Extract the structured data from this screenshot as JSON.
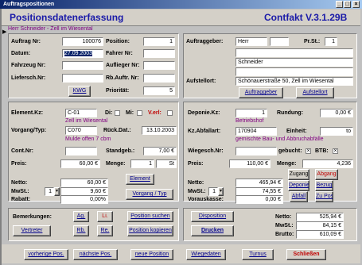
{
  "window": {
    "title": "Auftragspositionen",
    "minimize": "_",
    "maximize": "□",
    "close": "×"
  },
  "header": {
    "title": "Positionsdatenerfassung",
    "version": "Contfakt V.3.1.29B",
    "subtitle": "Herr Schneider - Zell im Wiesental"
  },
  "order": {
    "auftrag_nr_label": "Auftrag Nr:",
    "auftrag_nr": "100076",
    "position_label": "Position:",
    "position": "1",
    "datum_label": "Datum:",
    "datum": "27.09.2003",
    "fahrer_label": "Fahrer Nr:",
    "fahrer": "",
    "fahrzeug_label": "Fahrzeug Nr:",
    "fahrzeug": "",
    "auflieger_label": "Auflieger Nr:",
    "auflieger": "",
    "lieferschein_label": "Liefersch.Nr:",
    "lieferschein": "",
    "rb_label": "Rb.Auftr. Nr:",
    "rb": "",
    "prioritaet_label": "Priorität:",
    "prioritaet": "5",
    "kwg_button": "KWG"
  },
  "client": {
    "auftraggeber_label": "Auftraggeber:",
    "anrede": "Herr",
    "field2": "",
    "prst_label": "Pr.St.:",
    "prst": "1",
    "line1": "",
    "line2": "Schneider",
    "line3": "",
    "aufstellort_label": "Aufstellort:",
    "aufstellort": "Schönauerstraße 50, Zell im Wiesental",
    "auftraggeber_button": "Auftraggeber",
    "aufstellort_button": "Aufstellort"
  },
  "element": {
    "kz_label": "Element.Kz:",
    "kz": "C-01",
    "di_label": "Di:",
    "mi_label": "Mi:",
    "verl_label": "V.erl:",
    "location": "Zell im Wiesental",
    "vorgang_label": "Vorgang/Typ:",
    "vorgang": "C070",
    "rueck_label": "Rück.Dat.:",
    "rueck": "13.10.2003",
    "note": "Mulde offen 7 cbm",
    "cont_label": "Cont.Nr:",
    "cont": "",
    "standgeb_label": "Standgeb.:",
    "standgeb": "7,00 €",
    "preis_label": "Preis:",
    "preis": "60,00 €",
    "menge_label": "Menge:",
    "menge": "1",
    "einheit": "St",
    "element_button": "Element",
    "vorgang_button": "Vorgang / Typ",
    "netto_label": "Netto:",
    "netto": "60,00 €",
    "mwst_label": "MwSt.:",
    "mwst_code": "1",
    "mwst": "9,60 €",
    "rabatt_label": "Rabatt:",
    "rabatt": "0,00%"
  },
  "deponie": {
    "kz_label": "Deponie.Kz:",
    "kz": "1",
    "rundung_label": "Rundung:",
    "rundung": "0,00 €",
    "name": "Betriebshof",
    "abfall_label": "Kz.Abfallart:",
    "abfall": "170904",
    "einheit_label": "Einheit:",
    "einheit": "to",
    "abfall_name": "gemischte Bau- und Abbruchabfälle",
    "wiege_label": "Wiegesch.Nr:",
    "wiege": "",
    "gebucht_label": "gebucht:",
    "btb_label": "BTB:",
    "preis_label": "Preis:",
    "preis": "110,00 €",
    "menge_label": "Menge:",
    "menge": "4,236",
    "zugang_button": "Zugang",
    "abgang_button": "Abgang",
    "deponie_button": "Deponie",
    "abfall_button": "Abfall",
    "bezug_button": "Bezug",
    "zupos_button": "Zu Pos.",
    "netto_label": "Netto:",
    "netto": "465,94 €",
    "mwst_label": "MwSt.:",
    "mwst_code": "1",
    "mwst": "74,55 €",
    "voraus_label": "Vorauskasse:",
    "voraus": "0,00 €"
  },
  "remarks": {
    "label": "Bemerkungen:",
    "ag": "Ag.",
    "li": "Li.",
    "rb": "Rb.",
    "re": "Re.",
    "vertreter": "Vertreter",
    "pos_suchen": "Position suchen",
    "pos_kopieren": "Position kopieren"
  },
  "summary": {
    "disposition": "Disposition",
    "drucken": "Drucken",
    "netto_label": "Netto:",
    "netto": "525,94 €",
    "mwst_label": "MwSt.:",
    "mwst": "84,15 €",
    "brutto_label": "Brutto:",
    "brutto": "610,09 €"
  },
  "nav": {
    "prev": "vorherige Pos.",
    "next": "nächste Pos.",
    "new": "neue Position",
    "wiege": "Wiegedaten",
    "turnus": "Turnus",
    "close": "Schließen"
  }
}
